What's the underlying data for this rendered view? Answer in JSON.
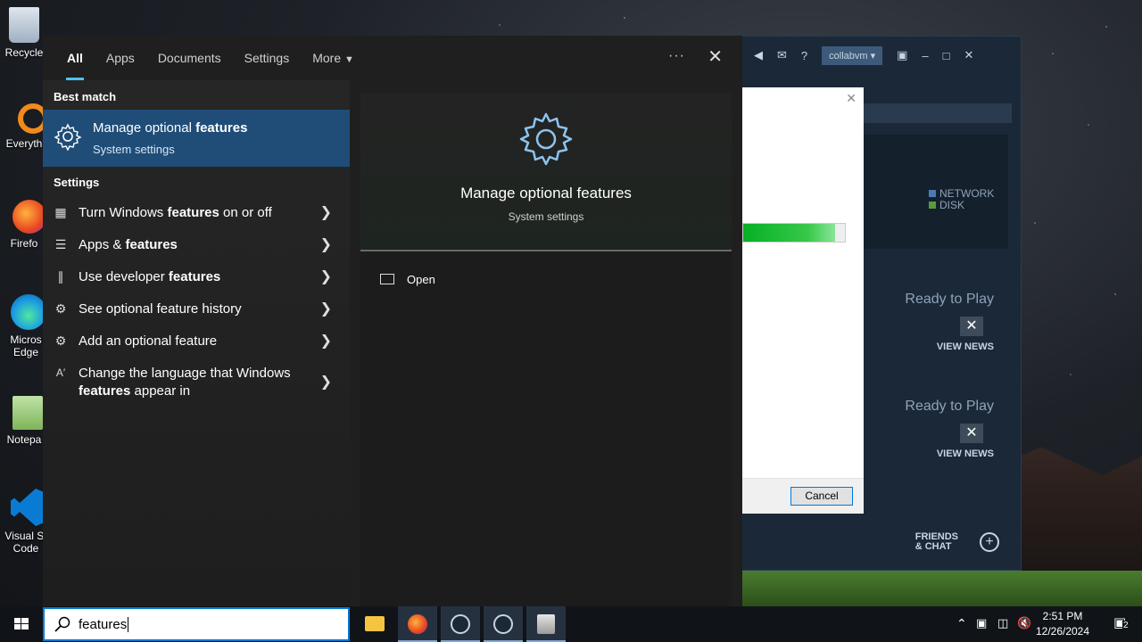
{
  "search_panel": {
    "tabs": [
      {
        "label": "All",
        "active": true
      },
      {
        "label": "Apps",
        "active": false
      },
      {
        "label": "Documents",
        "active": false
      },
      {
        "label": "Settings",
        "active": false
      },
      {
        "label": "More",
        "active": false
      }
    ],
    "more_options_glyph": "···",
    "best_match_heading": "Best match",
    "best_match": {
      "title_prefix": "Manage optional ",
      "title_bold": "features",
      "subtitle": "System settings",
      "icon": "gear-icon"
    },
    "settings_heading": "Settings",
    "settings_items": [
      {
        "icon": "toggle-features-icon",
        "pre": "Turn Windows ",
        "bold": "features",
        "post": " on or off"
      },
      {
        "icon": "apps-list-icon",
        "pre": "Apps & ",
        "bold": "features",
        "post": ""
      },
      {
        "icon": "developer-tools-icon",
        "pre": "Use developer ",
        "bold": "features",
        "post": ""
      },
      {
        "icon": "gear-icon",
        "pre": "See optional feature history",
        "bold": "",
        "post": ""
      },
      {
        "icon": "gear-icon",
        "pre": "Add an optional feature",
        "bold": "",
        "post": ""
      },
      {
        "icon": "language-icon",
        "pre": "Change the language that Windows ",
        "bold": "features",
        "post": " appear in"
      }
    ],
    "preview": {
      "title": "Manage optional features",
      "subtitle": "System settings",
      "actions": [
        {
          "label": "Open",
          "icon": "open-icon"
        }
      ]
    }
  },
  "taskbar": {
    "search_value": "features",
    "time": "2:51 PM",
    "date": "12/26/2024",
    "notification_count": "2"
  },
  "desktop_icons": [
    {
      "label": "Recycle",
      "icon": "recycle-bin-icon"
    },
    {
      "label": "Everyth",
      "icon": "everything-search-icon"
    },
    {
      "label": "Firefo",
      "icon": "firefox-icon"
    },
    {
      "label": "Micros Edge",
      "icon": "edge-icon"
    },
    {
      "label": "Notepa",
      "icon": "notepad-icon"
    },
    {
      "label": "Visual St Code",
      "icon": "vscode-icon"
    }
  ],
  "steam_window": {
    "username": "collabvm",
    "legend": [
      "NETWORK",
      "DISK"
    ],
    "legend_colors": [
      "#4a7ab5",
      "#5a9a3a"
    ],
    "games": [
      {
        "status": "Ready to Play",
        "view_news": "VIEW NEWS"
      },
      {
        "status": "Ready to Play",
        "view_news": "VIEW NEWS"
      }
    ],
    "friends_label_1": "FRIENDS",
    "friends_label_2": "& CHAT"
  },
  "dialog": {
    "progress": 0.9,
    "cancel_label": "Cancel"
  },
  "colors": {
    "accent": "#0078d7",
    "best_match_bg": "#1f4d78",
    "tab_underline": "#4cc2ff"
  }
}
